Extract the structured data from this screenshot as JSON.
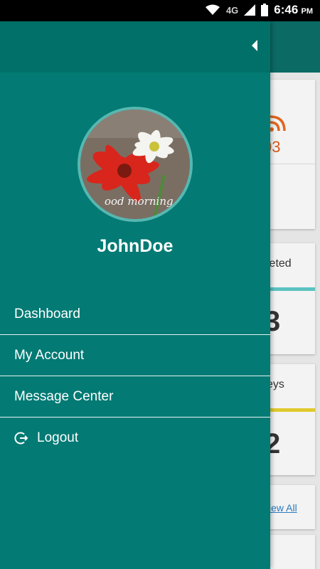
{
  "status_bar": {
    "network": "4G",
    "time": "6:46",
    "ampm": "PM"
  },
  "background": {
    "card1_value": "03",
    "card2_label": "leted",
    "card2_value": "3",
    "card3_label": "eys",
    "card3_value": "2",
    "view_all_link": "iew All"
  },
  "drawer": {
    "user": {
      "name": "JohnDoe",
      "avatar_caption": "ood morning"
    },
    "menu": [
      {
        "label": "Dashboard"
      },
      {
        "label": "My Account"
      },
      {
        "label": "Message Center"
      },
      {
        "label": "Logout",
        "icon": "logout-icon"
      }
    ]
  }
}
